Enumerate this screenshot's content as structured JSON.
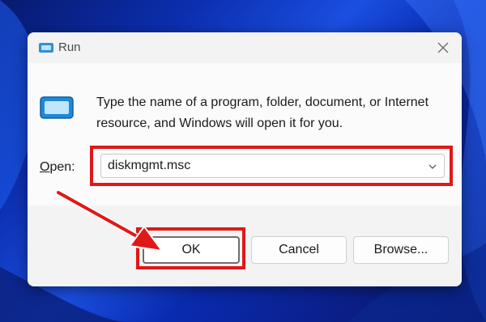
{
  "window": {
    "title": "Run",
    "icon": "run-icon",
    "close_icon": "close-icon"
  },
  "content": {
    "description": "Type the name of a program, folder, document, or Internet resource, and Windows will open it for you.",
    "open_label_underlined": "O",
    "open_label_rest": "pen:",
    "input_value": "diskmgmt.msc"
  },
  "buttons": {
    "ok_label": "OK",
    "cancel_label": "Cancel",
    "browse_label": "Browse..."
  },
  "annotations": {
    "highlight_color": "#e01818",
    "arrow_color": "#e01818"
  }
}
